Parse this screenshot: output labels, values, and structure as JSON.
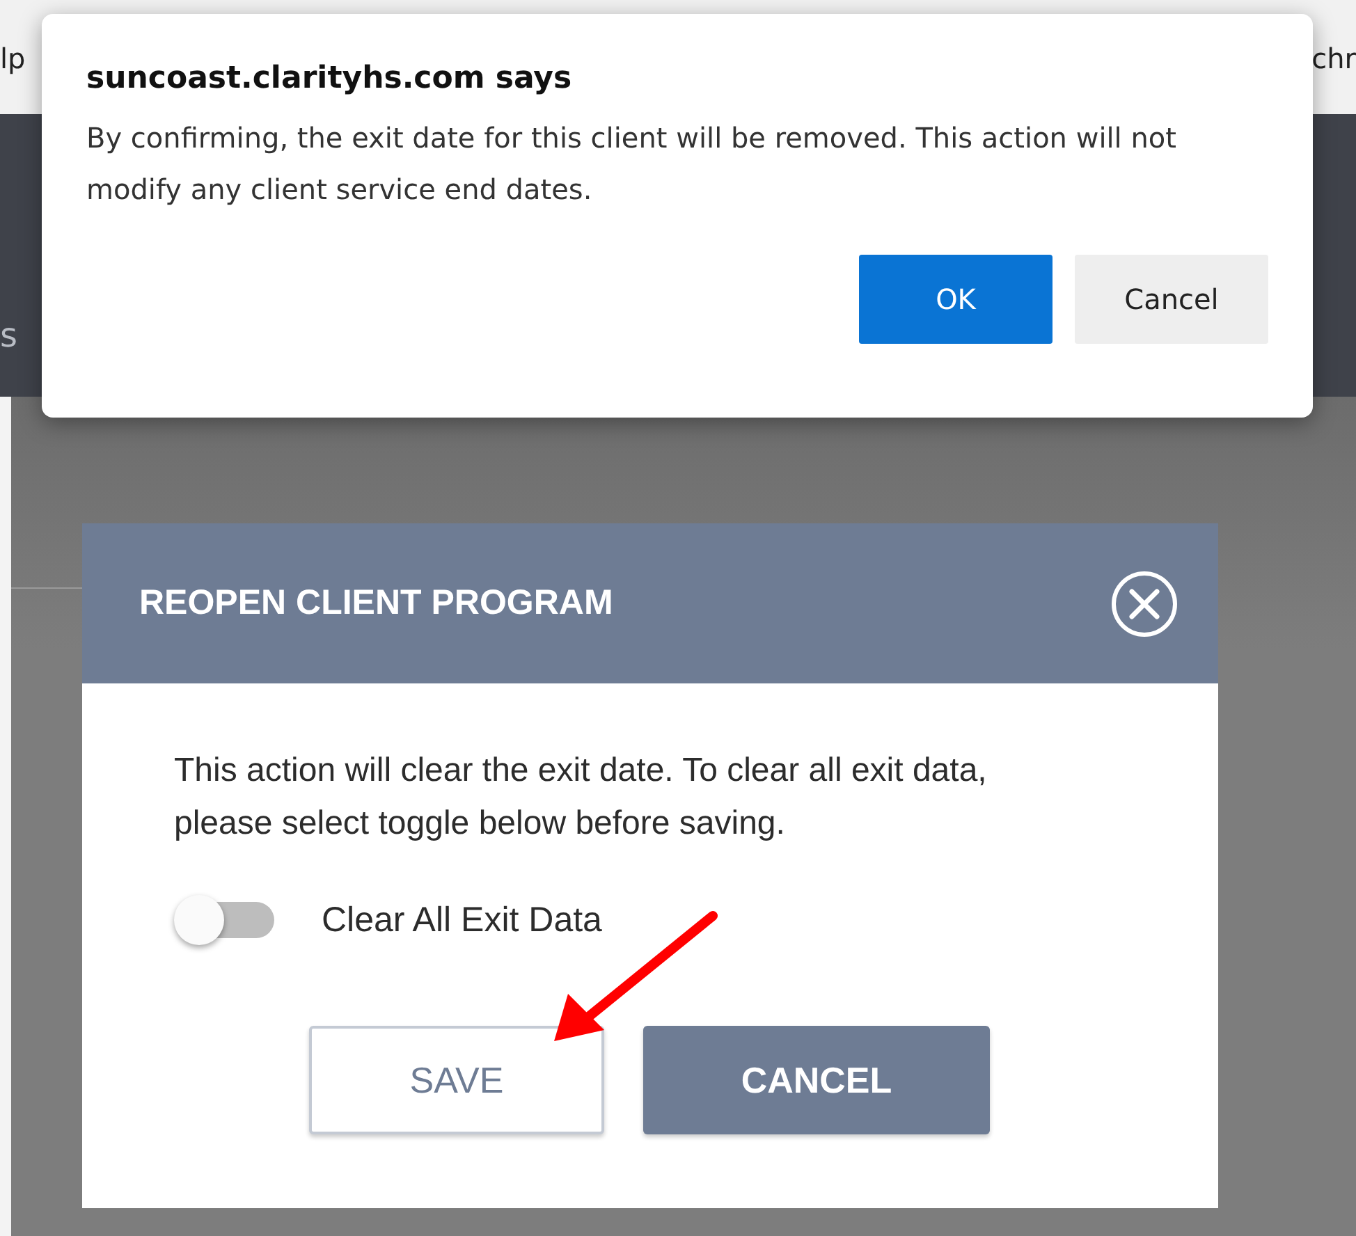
{
  "background": {
    "menu_left": "lp",
    "menu_right": "chr",
    "header_fragment": "s"
  },
  "alert": {
    "title": "suncoast.clarityhs.com says",
    "message": "By confirming, the exit date for this client will be removed. This action will not modify any client service end dates.",
    "buttons": [
      {
        "label": "OK",
        "kind": "primary"
      },
      {
        "label": "Cancel",
        "kind": "secondary"
      }
    ]
  },
  "modal": {
    "title": "REOPEN CLIENT PROGRAM",
    "message": "This action will clear the exit date. To clear all exit data, please select toggle below before saving.",
    "toggle": {
      "label": "Clear All Exit Data",
      "on": false
    },
    "buttons": [
      {
        "label": "SAVE",
        "kind": "outline"
      },
      {
        "label": "CANCEL",
        "kind": "filled"
      }
    ]
  }
}
